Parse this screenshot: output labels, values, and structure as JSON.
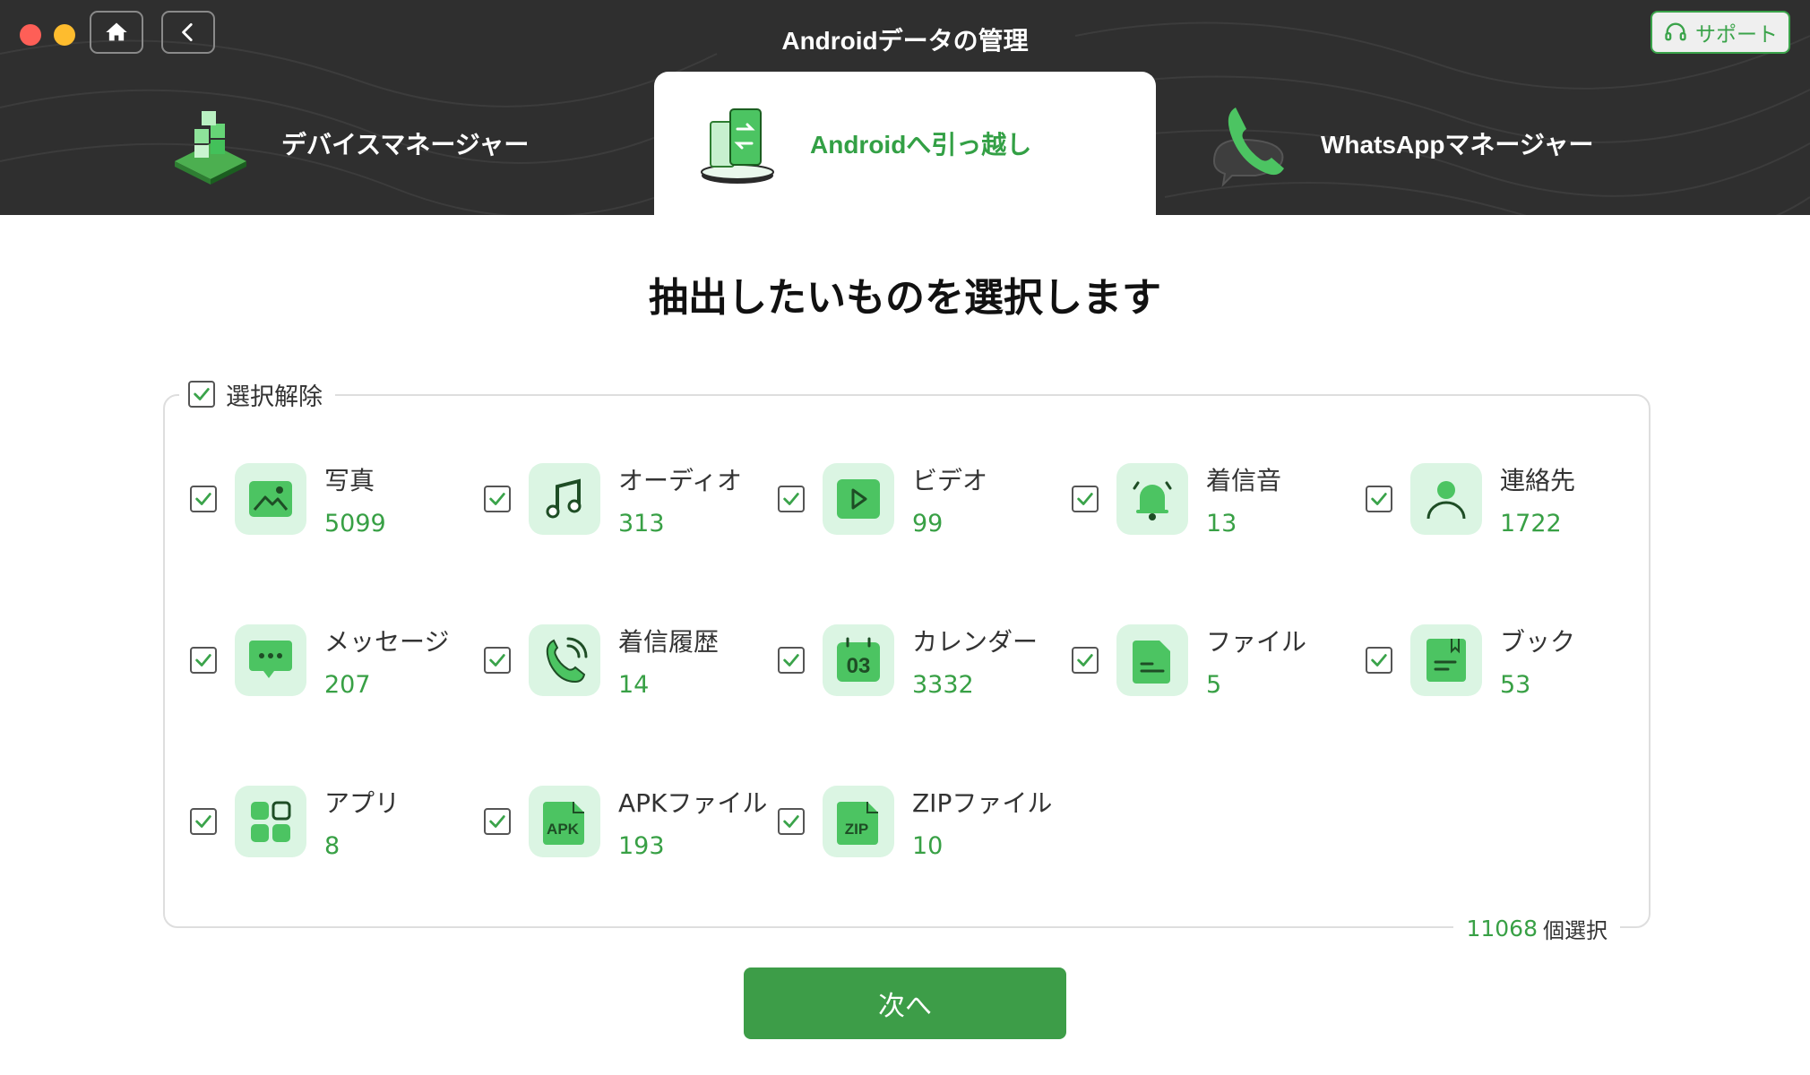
{
  "window": {
    "title": "Androidデータの管理",
    "support_label": "サポート"
  },
  "tabs": [
    {
      "label": "デバイスマネージャー",
      "icon": "device-cube-icon"
    },
    {
      "label": "Androidへ引っ越し",
      "icon": "phone-transfer-icon",
      "active": true
    },
    {
      "label": "WhatsAppマネージャー",
      "icon": "whatsapp-phone-icon"
    }
  ],
  "main": {
    "heading": "抽出したいものを選択します",
    "select_toggle_label": "選択解除",
    "items": [
      {
        "label": "写真",
        "count": "5099",
        "icon": "photo-icon"
      },
      {
        "label": "オーディオ",
        "count": "313",
        "icon": "music-note-icon"
      },
      {
        "label": "ビデオ",
        "count": "99",
        "icon": "video-play-icon"
      },
      {
        "label": "着信音",
        "count": "13",
        "icon": "bell-icon"
      },
      {
        "label": "連絡先",
        "count": "1722",
        "icon": "contact-person-icon"
      },
      {
        "label": "メッセージ",
        "count": "207",
        "icon": "message-bubble-icon"
      },
      {
        "label": "着信履歴",
        "count": "14",
        "icon": "phone-call-icon"
      },
      {
        "label": "カレンダー",
        "count": "3332",
        "icon": "calendar-icon"
      },
      {
        "label": "ファイル",
        "count": "5",
        "icon": "file-icon"
      },
      {
        "label": "ブック",
        "count": "53",
        "icon": "book-icon"
      },
      {
        "label": "アプリ",
        "count": "8",
        "icon": "apps-grid-icon"
      },
      {
        "label": "APKファイル",
        "count": "193",
        "icon": "apk-file-icon"
      },
      {
        "label": "ZIPファイル",
        "count": "10",
        "icon": "zip-file-icon"
      }
    ],
    "calendar_icon_text": "03",
    "apk_icon_text": "APK",
    "zip_icon_text": "ZIP",
    "selected_count": "11068",
    "selected_unit": "個選択",
    "next_label": "次へ"
  },
  "colors": {
    "accent_green": "#3d9d48",
    "count_green": "#38a045",
    "tile_bg": "#dbf5e3",
    "header_bg": "#2f2f2f"
  }
}
